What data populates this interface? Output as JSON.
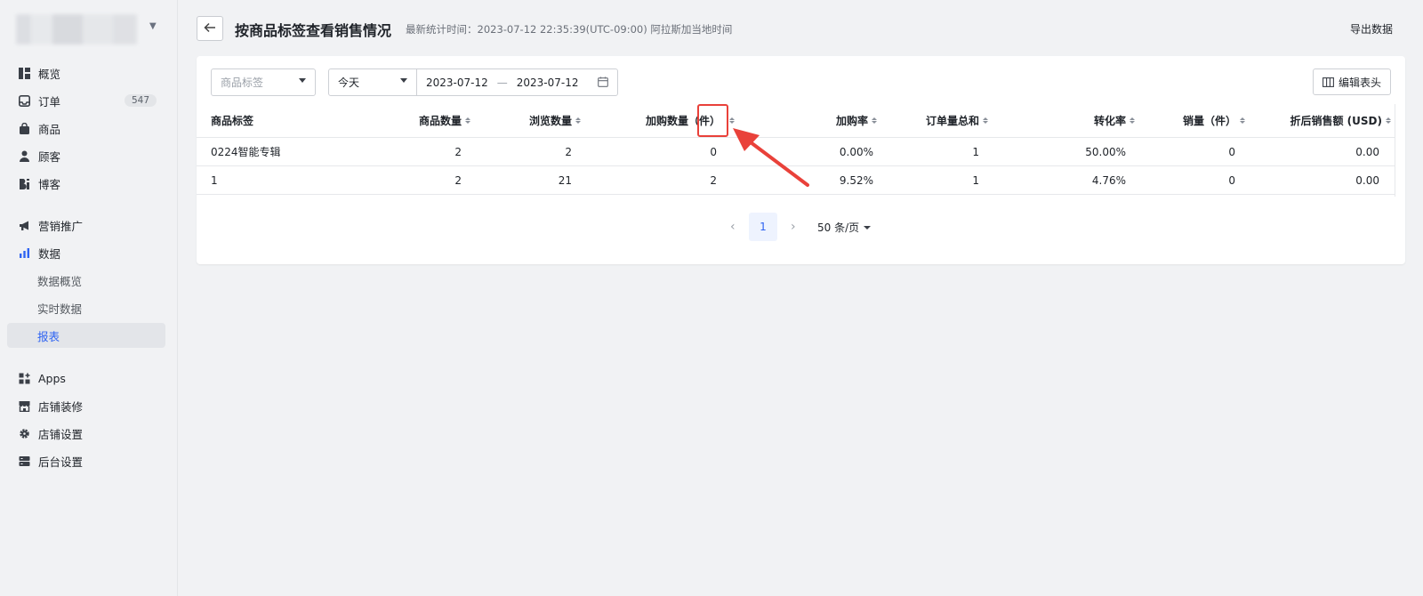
{
  "sidebar": {
    "items": [
      {
        "label": "概览",
        "icon": "dashboard-icon"
      },
      {
        "label": "订单",
        "icon": "inbox-icon",
        "badge": "547"
      },
      {
        "label": "商品",
        "icon": "bag-icon"
      },
      {
        "label": "顾客",
        "icon": "user-icon"
      },
      {
        "label": "博客",
        "icon": "blog-icon"
      },
      {
        "label": "营销推广",
        "icon": "megaphone-icon"
      },
      {
        "label": "数据",
        "icon": "bar-chart-icon"
      },
      {
        "label": "数据概览"
      },
      {
        "label": "实时数据"
      },
      {
        "label": "报表",
        "active": true
      },
      {
        "label": "Apps",
        "icon": "apps-icon"
      },
      {
        "label": "店铺装修",
        "icon": "store-icon"
      },
      {
        "label": "店铺设置",
        "icon": "gear-icon"
      },
      {
        "label": "后台设置",
        "icon": "server-icon"
      }
    ]
  },
  "header": {
    "title": "按商品标签查看销售情况",
    "meta": "最新统计时间：2023-07-12 22:35:39(UTC-09:00) 阿拉斯加当地时间",
    "export_label": "导出数据"
  },
  "filters": {
    "tag_placeholder": "商品标签",
    "range_value": "今天",
    "date_start": "2023-07-12",
    "date_sep": "—",
    "date_end": "2023-07-12",
    "edit_columns_label": "编辑表头"
  },
  "table": {
    "columns": [
      "商品标签",
      "商品数量",
      "浏览数量",
      "加购数量（件）",
      "加购率",
      "订单量总和",
      "转化率",
      "销量（件）",
      "折后销售额 (USD)"
    ],
    "rows": [
      [
        "0224智能专辑",
        "2",
        "2",
        "0",
        "0.00%",
        "1",
        "50.00%",
        "0",
        "0.00"
      ],
      [
        "1",
        "2",
        "21",
        "2",
        "9.52%",
        "1",
        "4.76%",
        "0",
        "0.00"
      ]
    ]
  },
  "pagination": {
    "prev": "‹",
    "current": "1",
    "next": "›",
    "page_size": "50 条/页"
  },
  "colors": {
    "accent": "#2e63f2",
    "annotation": "#e9413a"
  }
}
